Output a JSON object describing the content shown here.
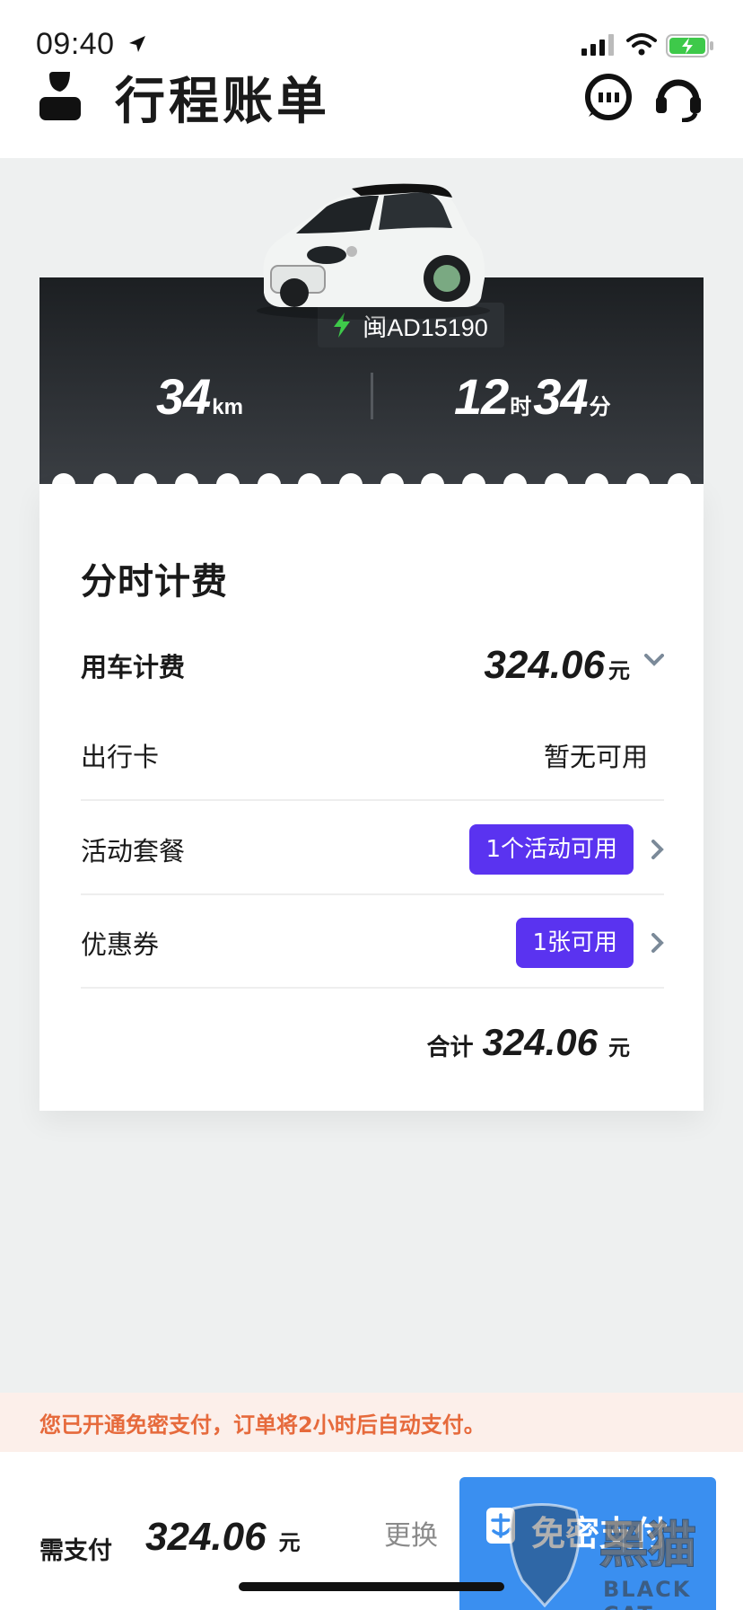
{
  "status_bar": {
    "time": "09:40"
  },
  "header": {
    "title": "行程账单"
  },
  "trip": {
    "plate": "闽AD15190",
    "distance_value": "34",
    "distance_unit": "km",
    "hours": "12",
    "hours_unit": "时",
    "minutes": "34",
    "minutes_unit": "分"
  },
  "fees": {
    "section_title": "分时计费",
    "usage_label": "用车计费",
    "usage_amount": "324.06",
    "currency": "元",
    "travel_card_label": "出行卡",
    "travel_card_value": "暂无可用",
    "promo_label": "活动套餐",
    "promo_value": "1个活动可用",
    "coupon_label": "优惠券",
    "coupon_value": "1张可用",
    "total_label": "合计",
    "total_amount": "324.06"
  },
  "notice": {
    "text": "您已开通免密支付，订单将2小时后自动支付。"
  },
  "bottom": {
    "pay_label": "需支付",
    "pay_amount": "324.06",
    "currency": "元",
    "change_label": "更换",
    "pay_button_label": "免密支付"
  },
  "watermark": {
    "brand_cn": "黑猫",
    "brand_en": "BLACK CAT"
  },
  "colors": {
    "accent_purple": "#5a33f0",
    "notice_orange": "#e66a3c",
    "pay_blue": "#3a8ff0",
    "bolt_green": "#3ec94a"
  }
}
